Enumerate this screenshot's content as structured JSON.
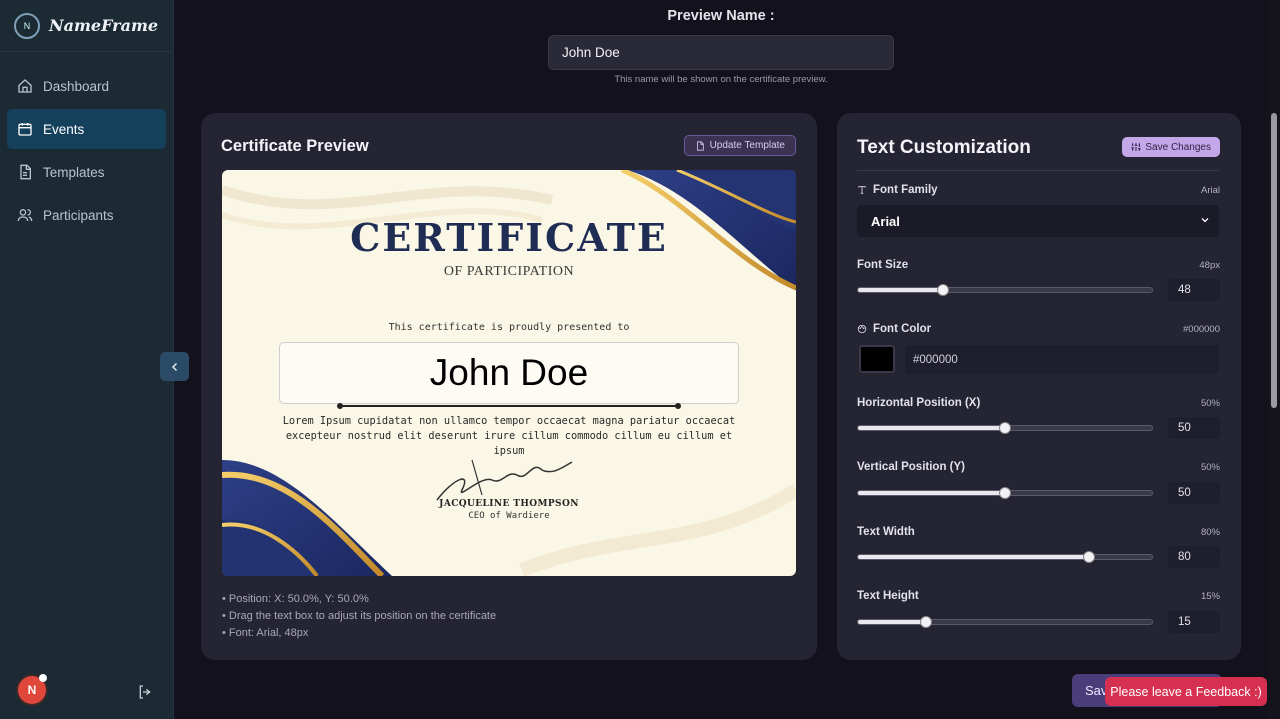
{
  "app": {
    "name": "NameFrame",
    "logo_text": "N"
  },
  "sidebar": {
    "items": [
      {
        "label": "Dashboard",
        "icon": "home-icon"
      },
      {
        "label": "Events",
        "icon": "calendar-icon",
        "active": true
      },
      {
        "label": "Templates",
        "icon": "file-icon"
      },
      {
        "label": "Participants",
        "icon": "users-icon"
      }
    ],
    "avatar_initial": "N"
  },
  "preview": {
    "label": "Preview Name :",
    "value": "John Doe",
    "hint": "This name will be shown on the certificate preview."
  },
  "certificate_card": {
    "title": "Certificate Preview",
    "update_button": "Update Template",
    "certificate": {
      "title": "CERTIFICATE",
      "subtitle": "OF PARTICIPATION",
      "presented": "This certificate is proudly presented to",
      "name": "John Doe",
      "body": "Lorem Ipsum cupidatat non ullamco tempor occaecat magna pariatur occaecat excepteur nostrud elit deserunt irure cillum commodo cillum eu cillum et ipsum",
      "signature_name": "JACQUELINE THOMPSON",
      "signature_role": "CEO of Wardiere"
    },
    "info": [
      "• Position: X: 50.0%, Y: 50.0%",
      "• Drag the text box to adjust its position on the certificate",
      "• Font: Arial, 48px"
    ]
  },
  "customization": {
    "title": "Text Customization",
    "save_button": "Save Changes",
    "font_family": {
      "label": "Font Family",
      "value_badge": "Arial",
      "selected": "Arial"
    },
    "font_size": {
      "label": "Font Size",
      "badge": "48px",
      "value": "48",
      "fraction": 0.29
    },
    "font_color": {
      "label": "Font Color",
      "badge": "#000000",
      "value": "#000000"
    },
    "horizontal": {
      "label": "Horizontal Position (X)",
      "badge": "50%",
      "value": "50",
      "fraction": 0.5
    },
    "vertical": {
      "label": "Vertical Position (Y)",
      "badge": "50%",
      "value": "50",
      "fraction": 0.5
    },
    "width": {
      "label": "Text Width",
      "badge": "80%",
      "value": "80",
      "fraction": 0.787
    },
    "height": {
      "label": "Text Height",
      "badge": "15%",
      "value": "15",
      "fraction": 0.23
    }
  },
  "bottom": {
    "save_label": "Sav",
    "feedback": "Please leave a Feedback :)"
  },
  "colors": {
    "accent": "#c4a7e8",
    "active_nav": "#15405c",
    "feedback": "#d53050",
    "cert_navy": "#1f2d55",
    "cert_gold": "#d9a23b"
  }
}
